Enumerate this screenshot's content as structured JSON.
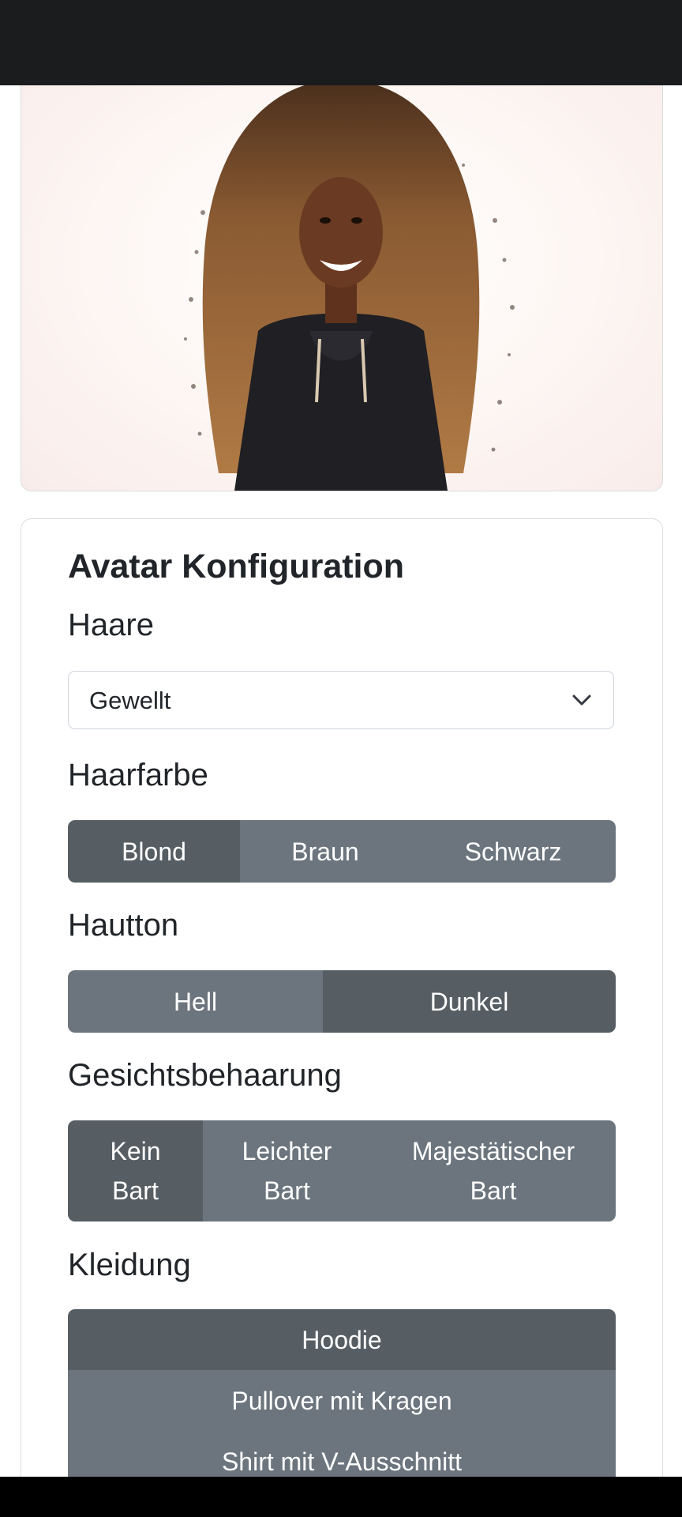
{
  "config": {
    "title": "Avatar Konfiguration",
    "hair": {
      "label": "Haare",
      "selected": "Gewellt"
    },
    "hair_color": {
      "label": "Haarfarbe",
      "options": [
        "Blond",
        "Braun",
        "Schwarz"
      ],
      "active": "Blond"
    },
    "skin_tone": {
      "label": "Hautton",
      "options": [
        "Hell",
        "Dunkel"
      ],
      "active": "Dunkel"
    },
    "facial_hair": {
      "label": "Gesichtsbehaarung",
      "options": [
        "Kein Bart",
        "Leichter Bart",
        "Majestätischer Bart"
      ],
      "active": "Kein Bart"
    },
    "clothing": {
      "label": "Kleidung",
      "options": [
        "Hoodie",
        "Pullover mit Kragen",
        "Shirt mit V-Ausschnitt"
      ],
      "active": "Hoodie"
    }
  },
  "colors": {
    "status_bar": "#1b1c1e",
    "button": "#6c757d",
    "button_active": "#565e64",
    "hair": "#8a5a32",
    "hoodie": "#1f1f24",
    "skin": "#6b3a22"
  },
  "icons": {
    "select_chevron": "chevron-down-icon"
  }
}
